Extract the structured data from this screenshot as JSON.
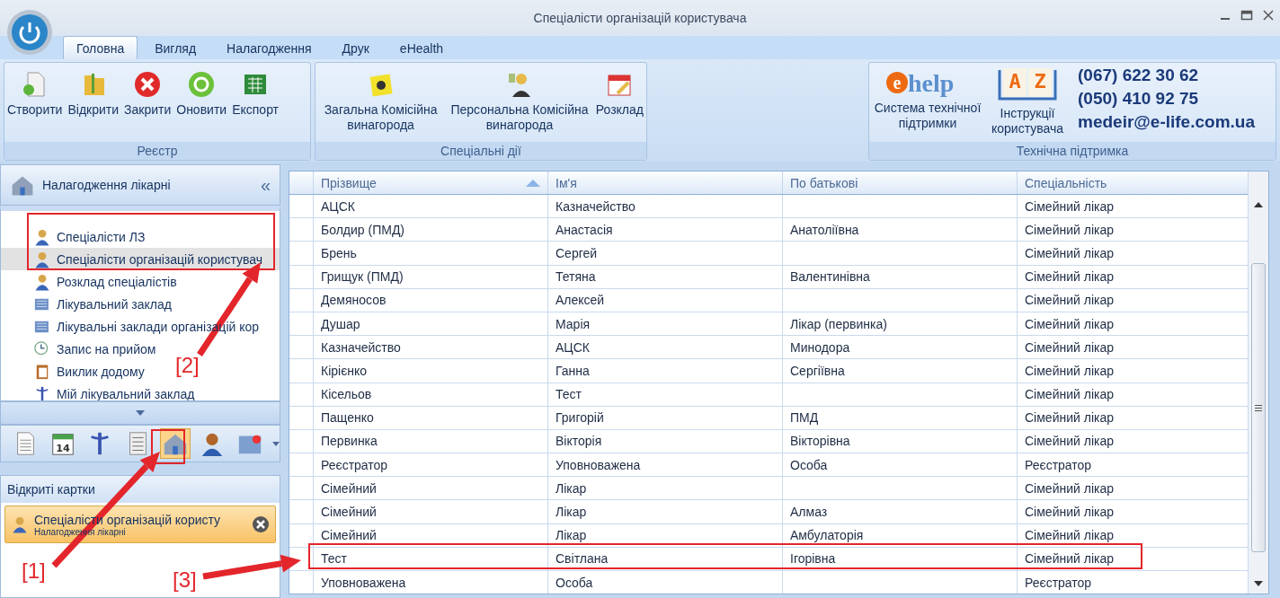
{
  "window": {
    "title": "Спеціалісти організацій користувача"
  },
  "ribbon": {
    "tabs": [
      {
        "label": "Головна",
        "selected": true
      },
      {
        "label": "Вигляд",
        "selected": false
      },
      {
        "label": "Налагодження",
        "selected": false
      },
      {
        "label": "Друк",
        "selected": false
      },
      {
        "label": "eHealth",
        "selected": false
      }
    ],
    "groups": [
      {
        "title": "Реєстр",
        "buttons": [
          {
            "label": "Створити"
          },
          {
            "label": "Відкрити"
          },
          {
            "label": "Закрити"
          },
          {
            "label": "Оновити"
          },
          {
            "label": "Експорт"
          }
        ]
      },
      {
        "title": "Спеціальні дії",
        "buttons": [
          {
            "label": "Загальна Комісійна винагорода"
          },
          {
            "label": "Персональна Комісійна винагорода"
          },
          {
            "label": "Розклад"
          }
        ]
      }
    ],
    "support": {
      "title": "Технічна підтримка",
      "logo_e": "e",
      "logo_help": "help",
      "book_letters": [
        "A",
        "Z"
      ],
      "buttons": [
        {
          "label": "Система технічної підтримки"
        },
        {
          "label": "Інструкції користувача"
        }
      ],
      "contacts": [
        "(067) 622 30 62",
        "(050) 410 92 75",
        "medeir@e-life.com.ua"
      ]
    }
  },
  "sidebar": {
    "title": "Налагодження лікарні",
    "collapse": "«",
    "items": [
      {
        "label": "Спеціалісти ЛЗ",
        "selected": false
      },
      {
        "label": "Спеціалісти організацій користувач",
        "selected": true
      },
      {
        "label": "Розклад спеціалістів",
        "selected": false
      },
      {
        "label": "Лікувальний заклад",
        "selected": false
      },
      {
        "label": "Лікувальні заклади організацій кор",
        "selected": false
      },
      {
        "label": "Запис на прийом",
        "selected": false
      },
      {
        "label": "Виклик додому",
        "selected": false
      },
      {
        "label": "Мій лікувальний заклад",
        "selected": false
      }
    ],
    "toolbar": [
      {
        "selected": false
      },
      {
        "selected": false,
        "text": "14"
      },
      {
        "selected": false
      },
      {
        "selected": false
      },
      {
        "selected": true
      },
      {
        "selected": false
      },
      {
        "selected": false
      }
    ],
    "open_cards": {
      "title": "Відкриті картки",
      "cards": [
        {
          "title": "Спеціалісти організацій користу",
          "subtitle": "Налагодження лікарні"
        }
      ]
    }
  },
  "table": {
    "columns": [
      {
        "label": "Прізвище",
        "sorted": true
      },
      {
        "label": "Ім'я",
        "sorted": false
      },
      {
        "label": "По батькові",
        "sorted": false
      },
      {
        "label": "Спеціальність",
        "sorted": false
      }
    ],
    "rows": [
      [
        "АЦСК",
        "Казначейство",
        "",
        "Сімейний лікар"
      ],
      [
        "Болдир (ПМД)",
        "Анастасія",
        "Анатоліївна",
        "Сімейний лікар"
      ],
      [
        "Брень",
        "Сергей",
        "",
        "Сімейний лікар"
      ],
      [
        "Грищук (ПМД)",
        "Тетяна",
        "Валентинівна",
        "Сімейний лікар"
      ],
      [
        "Демяносов",
        "Алексей",
        "",
        "Сімейний лікар"
      ],
      [
        "Душар",
        "Марія",
        "Лікар (первинка)",
        "Сімейний лікар"
      ],
      [
        "Казначейство",
        "АЦСК",
        "Минодора",
        "Сімейний лікар"
      ],
      [
        "Кірієнко",
        "Ганна",
        "Сергіївна",
        "Сімейний лікар"
      ],
      [
        "Кісельов",
        "Тест",
        "",
        "Сімейний лікар"
      ],
      [
        "Пащенко",
        "Григорій",
        "ПМД",
        "Сімейний лікар"
      ],
      [
        "Первинка",
        "Вікторія",
        "Вікторівна",
        "Сімейний лікар"
      ],
      [
        "Реєстратор",
        "Уповноважена",
        "Особа",
        "Реєстратор"
      ],
      [
        "Сімейний",
        "Лікар",
        "",
        "Сімейний лікар"
      ],
      [
        "Сімейний",
        "Лікар",
        "Алмаз",
        "Сімейний лікар"
      ],
      [
        "Сімейний",
        "Лікар",
        "Амбулаторія",
        "Сімейний лікар"
      ],
      [
        "Тест",
        "Світлана",
        "Ігорівна",
        "Сімейний лікар"
      ],
      [
        "Уповноважена",
        "Особа",
        "",
        "Реєстратор"
      ]
    ]
  },
  "annotations": [
    {
      "label": "[1]"
    },
    {
      "label": "[2]"
    },
    {
      "label": "[3]"
    }
  ]
}
